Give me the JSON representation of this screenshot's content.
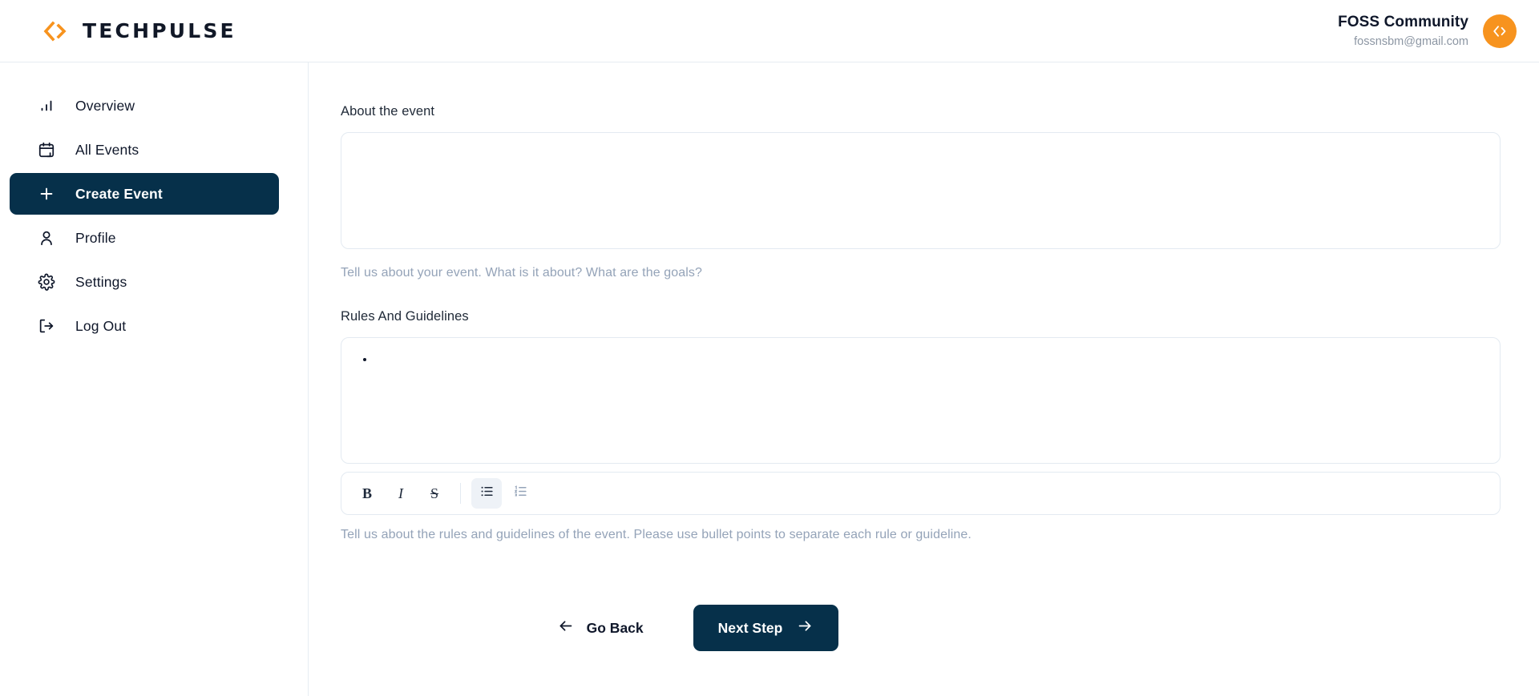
{
  "brand": {
    "name": "TECHPULSE",
    "logo_icon": "code-brackets-icon",
    "accent_color": "#f7931e"
  },
  "header": {
    "user_name": "FOSS Community",
    "user_email": "fossnsbm@gmail.com",
    "avatar_icon": "code-brackets-icon"
  },
  "sidebar": {
    "items": [
      {
        "label": "Overview",
        "icon": "bar-chart-icon",
        "active": false
      },
      {
        "label": "All Events",
        "icon": "calendar-icon",
        "active": false
      },
      {
        "label": "Create Event",
        "icon": "plus-icon",
        "active": true
      },
      {
        "label": "Profile",
        "icon": "user-icon",
        "active": false
      },
      {
        "label": "Settings",
        "icon": "gear-icon",
        "active": false
      },
      {
        "label": "Log Out",
        "icon": "logout-icon",
        "active": false
      }
    ],
    "active_color": "#06304a"
  },
  "main": {
    "about": {
      "label": "About the event",
      "value": "",
      "placeholder": "",
      "helper": "Tell us about your event. What is it about? What are the goals?"
    },
    "rules": {
      "label": "Rules And Guidelines",
      "bullets": [
        ""
      ],
      "helper": "Tell us about the rules and guidelines of the event. Please use bullet points to separate each rule or guideline."
    },
    "toolbar": {
      "bold_label": "B",
      "italic_label": "I",
      "strike_label": "S",
      "bullet_list_icon": "bullet-list-icon",
      "ordered_list_icon": "ordered-list-icon",
      "active_tool": "bullet-list"
    },
    "actions": {
      "back_label": "Go Back",
      "back_icon": "arrow-left-icon",
      "next_label": "Next Step",
      "next_icon": "arrow-right-icon",
      "next_bg": "#06304a"
    }
  }
}
